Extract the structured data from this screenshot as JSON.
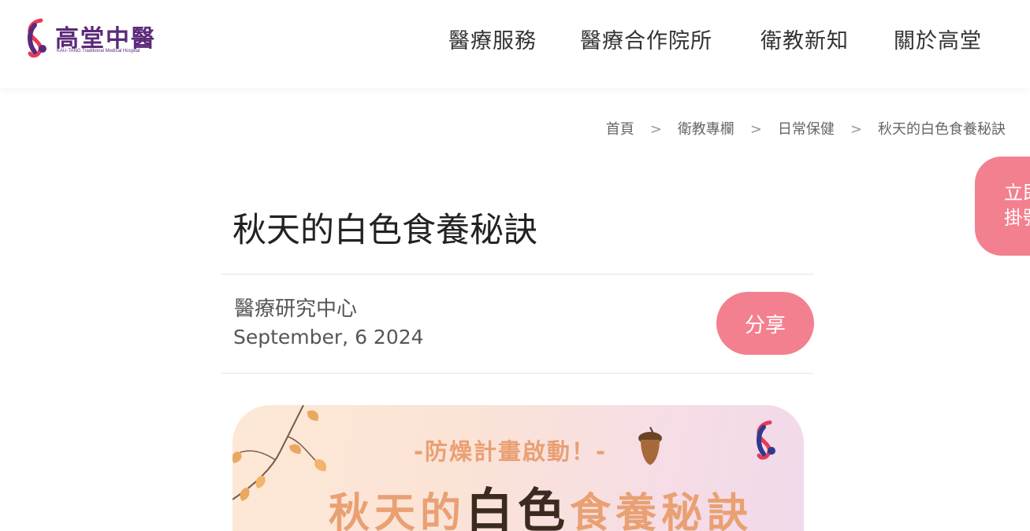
{
  "brand": {
    "name": "高堂中醫",
    "subtitle": "KAU-TANG Traditional Medical Hospital",
    "color": "#5b2a7a",
    "accent": "#e63a5a"
  },
  "nav": {
    "items": [
      {
        "label": "醫療服務"
      },
      {
        "label": "醫療合作院所"
      },
      {
        "label": "衛教新知"
      },
      {
        "label": "關於高堂"
      }
    ]
  },
  "breadcrumb": {
    "items": [
      "首頁",
      "衛教專欄",
      "日常保健",
      "秋天的白色食養秘訣"
    ],
    "separator": ">"
  },
  "float_button": {
    "label": "立即掛號"
  },
  "article": {
    "title": "秋天的白色食養秘訣",
    "author": "醫療研究中心",
    "date": "September, 6 2024",
    "share_label": "分享"
  },
  "banner": {
    "tag": "-防燥計畫啟動！-",
    "headline_a": "秋天的",
    "headline_b": "白色",
    "headline_c": "食養秘訣"
  },
  "colors": {
    "pink": "#f3808f",
    "orange": "#e9a073"
  }
}
